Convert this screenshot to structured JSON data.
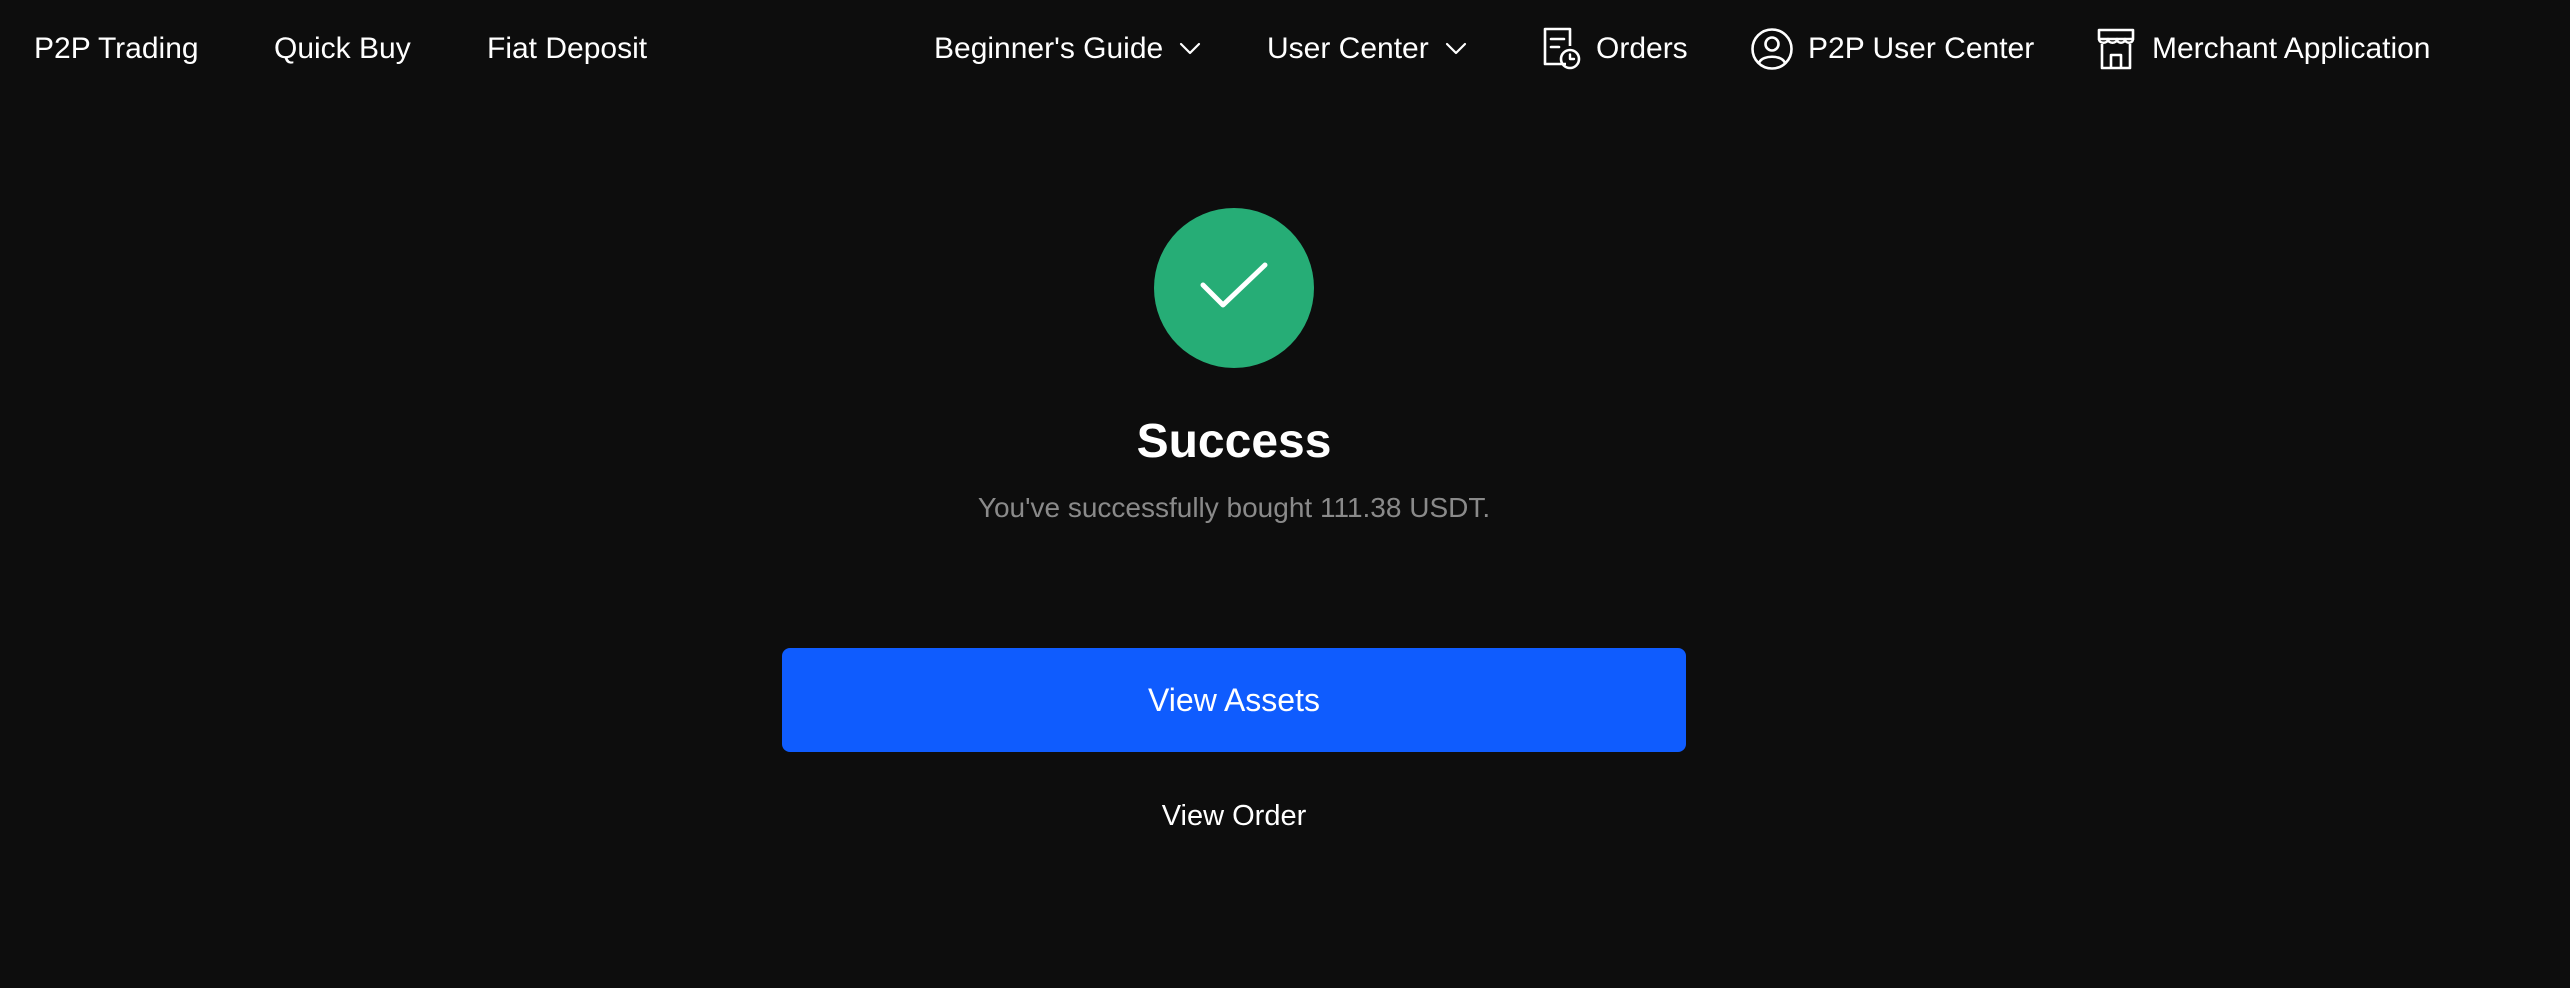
{
  "nav": {
    "left": [
      {
        "label": "P2P Trading"
      },
      {
        "label": "Quick Buy"
      },
      {
        "label": "Fiat Deposit"
      }
    ],
    "right": {
      "beginners_guide": {
        "label": "Beginner's Guide",
        "icon": "chevron-down-icon"
      },
      "user_center": {
        "label": "User Center",
        "icon": "chevron-down-icon"
      },
      "orders": {
        "label": "Orders",
        "icon": "orders-icon"
      },
      "p2p_user_center": {
        "label": "P2P User Center",
        "icon": "user-circle-icon"
      },
      "merchant_application": {
        "label": "Merchant Application",
        "icon": "store-icon"
      }
    }
  },
  "result": {
    "icon": "checkmark-icon",
    "title": "Success",
    "message": "You've successfully bought 111.38 USDT."
  },
  "actions": {
    "primary_label": "View Assets",
    "secondary_label": "View Order"
  },
  "colors": {
    "background": "#0d0d0d",
    "success": "#26ad76",
    "primary": "#0f5cfe",
    "muted_text": "#8a8a8a"
  }
}
